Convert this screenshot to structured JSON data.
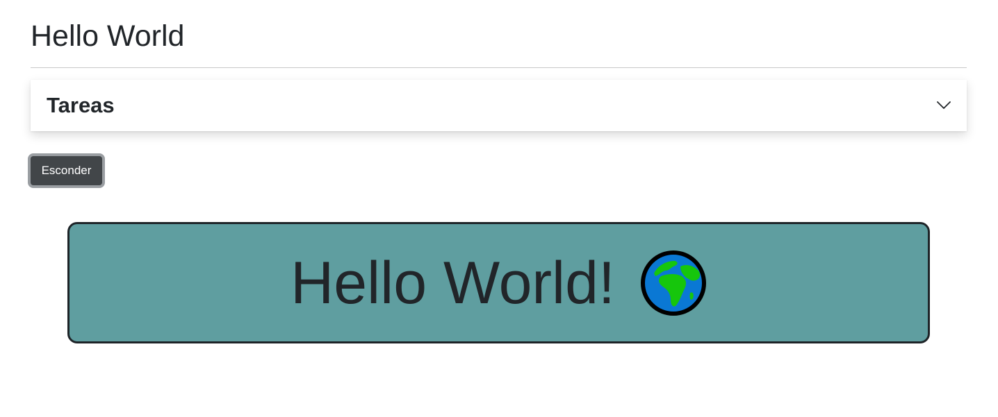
{
  "header": {
    "title": "Hello World"
  },
  "accordion": {
    "title": "Tareas",
    "expand_icon": "chevron-down-icon"
  },
  "controls": {
    "hide_label": "Esconder"
  },
  "banner": {
    "message": "Hello World!",
    "icon": "globe-africa-icon",
    "background_color": "#5f9ea0"
  }
}
